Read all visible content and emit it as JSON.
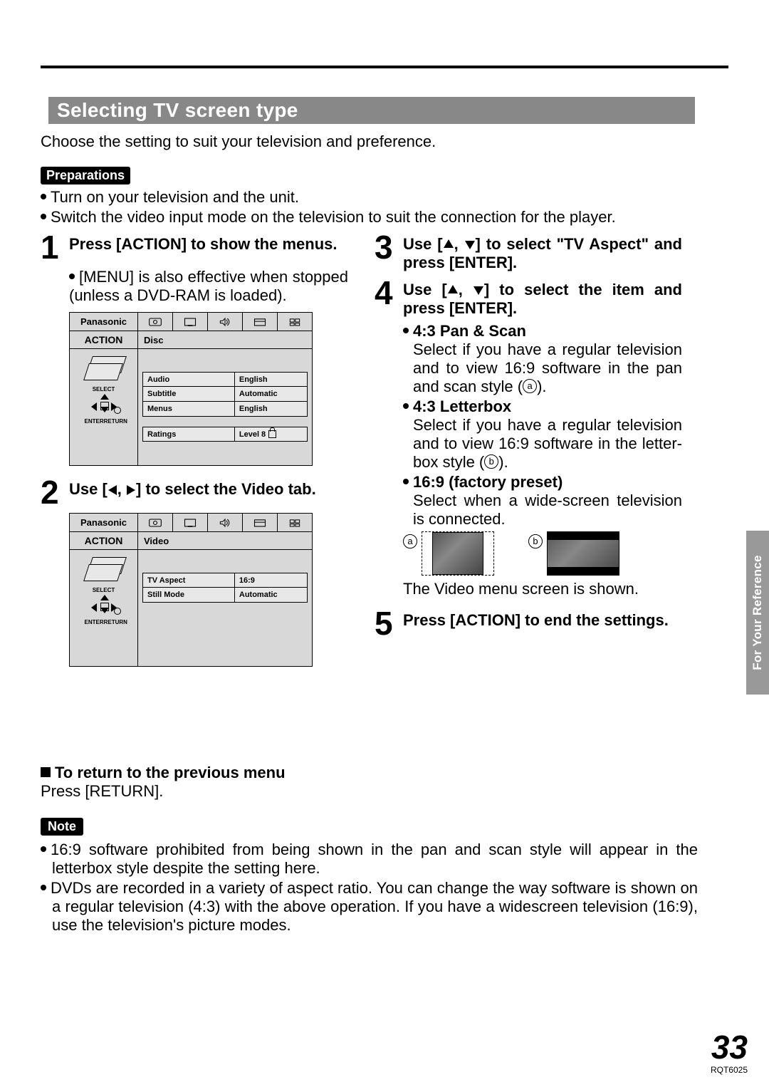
{
  "heading": "Selecting TV screen type",
  "intro": "Choose the setting to suit your television and preference.",
  "preparations_label": "Preparations",
  "preparations": [
    "Turn on your television and the unit.",
    "Switch the video input mode on the television to suit the connection for the player."
  ],
  "steps": {
    "s1": {
      "num": "1",
      "head": "Press [ACTION] to show the menus.",
      "body": "[MENU] is also effective when stopped (unless a DVD-RAM is loaded)."
    },
    "s2": {
      "num": "2",
      "head_pre": "Use [",
      "head_mid": ", ",
      "head_post": "] to select the Video tab."
    },
    "s3": {
      "num": "3",
      "head_pre": "Use [",
      "head_mid": ", ",
      "head_post": "] to select \"TV Aspect\" and press [ENTER]."
    },
    "s4": {
      "num": "4",
      "head_pre": "Use [",
      "head_mid": ", ",
      "head_post": "] to select the item and press [ENTER].",
      "items": [
        {
          "title": "4:3 Pan & Scan",
          "desc_pre": "Select if you have a regular television and to view 16:9 software in the pan and scan style (",
          "ref": "a",
          "desc_post": ")."
        },
        {
          "title": "4:3 Letterbox",
          "desc_pre": "Select if you have a regular television and to view 16:9 software in the letter-box style (",
          "ref": "b",
          "desc_post": ")."
        },
        {
          "title": "16:9 (factory preset)",
          "desc_pre": "Select when a wide-screen television is connected.",
          "ref": "",
          "desc_post": ""
        }
      ],
      "ab_a": "a",
      "ab_b": "b",
      "after": "The Video menu screen is shown."
    },
    "s5": {
      "num": "5",
      "head": "Press [ACTION] to end the settings."
    }
  },
  "menu": {
    "brand": "Panasonic",
    "action": "ACTION",
    "select": "SELECT",
    "enter": "ENTER",
    "return": "RETURN",
    "disc_tab": "Disc",
    "disc_rows": [
      {
        "k": "Audio",
        "v": "English"
      },
      {
        "k": "Subtitle",
        "v": "Automatic"
      },
      {
        "k": "Menus",
        "v": "English"
      }
    ],
    "ratings_k": "Ratings",
    "ratings_v": "Level 8",
    "video_tab": "Video",
    "video_rows": [
      {
        "k": "TV Aspect",
        "v": "16:9"
      },
      {
        "k": "Still Mode",
        "v": "Automatic"
      }
    ]
  },
  "return_head": "To return to the previous menu",
  "return_body": "Press [RETURN].",
  "note_label": "Note",
  "notes": [
    "16:9 software prohibited from being shown in the pan and scan style will appear in the letterbox style despite the setting here.",
    "DVDs are recorded in a variety of aspect ratio. You can change the way software is shown on a regular television (4:3) with the above operation. If you have a widescreen television (16:9), use the television's picture modes."
  ],
  "side_tab": "For Your Reference",
  "page_num": "33",
  "doc_id": "RQT6025"
}
